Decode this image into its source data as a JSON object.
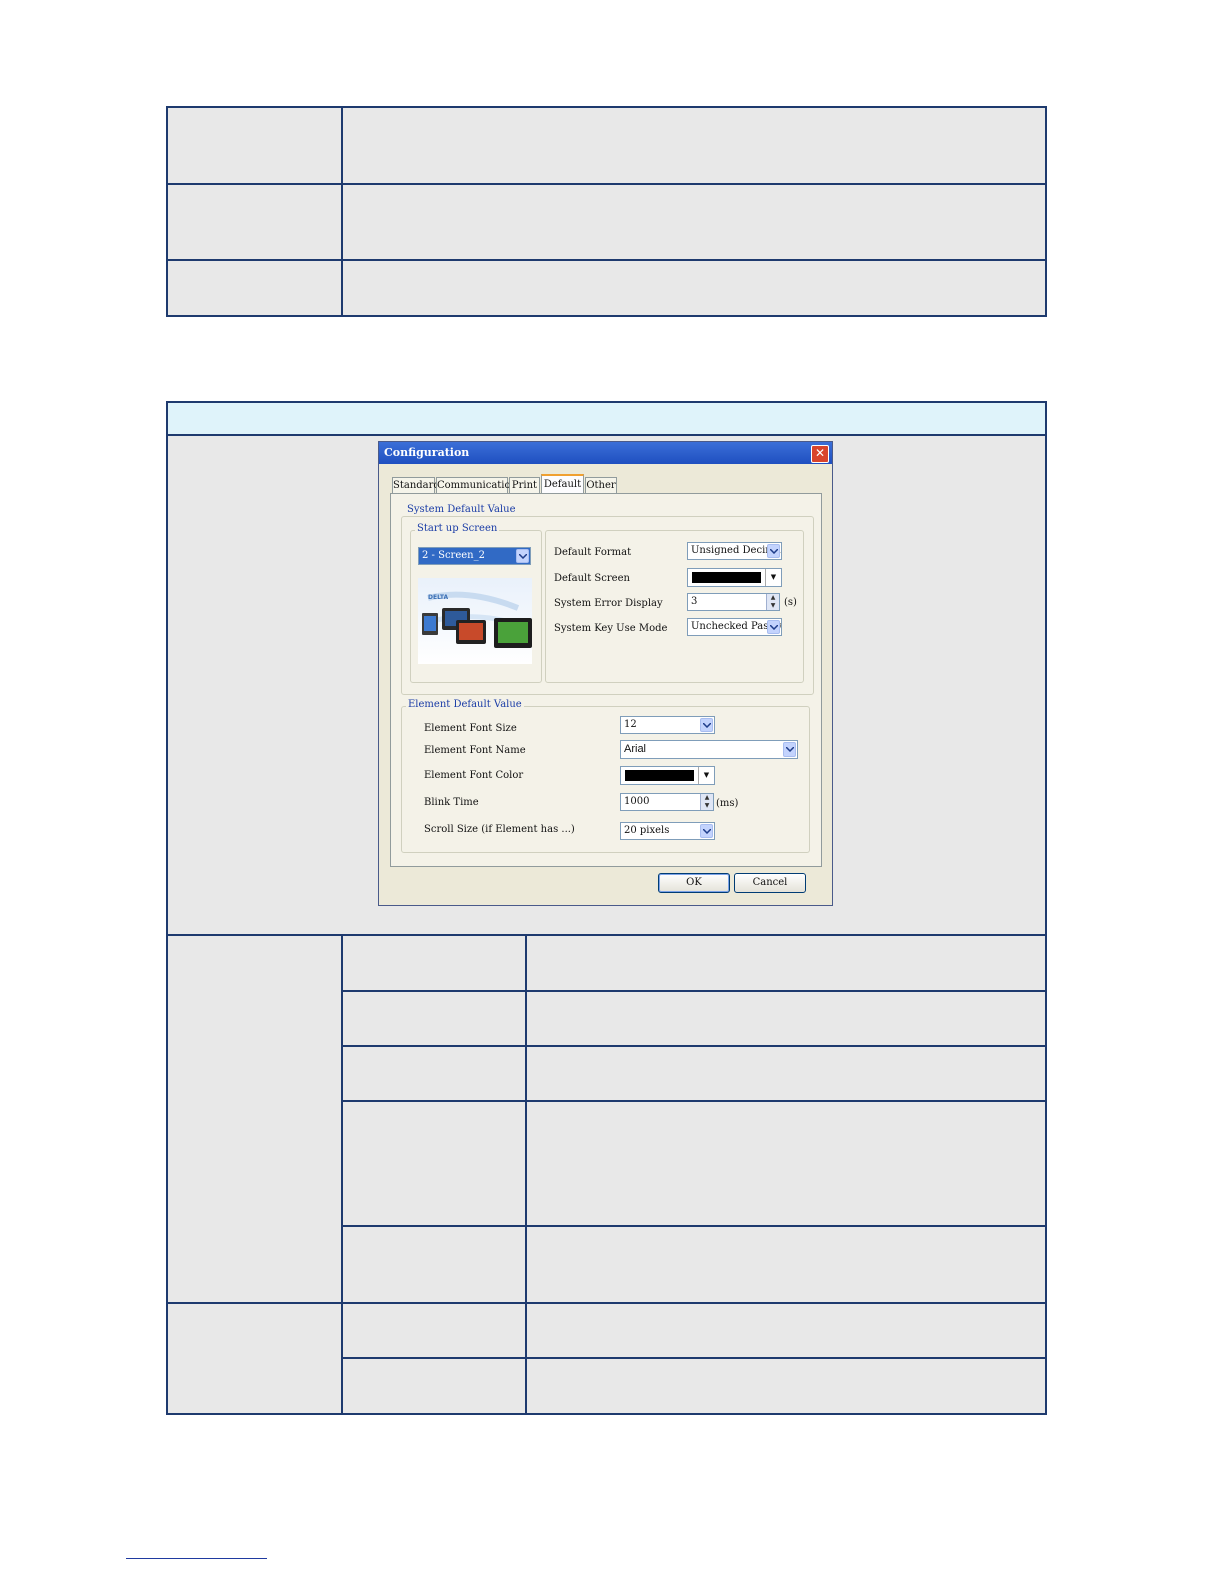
{
  "dialog": {
    "title": "Configuration",
    "close_glyph": "✕",
    "tabs": [
      {
        "label": "Standard"
      },
      {
        "label": "Communication"
      },
      {
        "label": "Print"
      },
      {
        "label": "Default",
        "active": true
      },
      {
        "label": "Other"
      }
    ],
    "system_default": {
      "group_label": "System Default Value",
      "startup": {
        "group_label": "Start up Screen",
        "selected": "2 - Screen_2",
        "thumbnail_logo": "DELTA"
      },
      "default_format": {
        "label": "Default Format",
        "value": "Unsigned Decimal"
      },
      "default_screen": {
        "label": "Default Screen",
        "color": "#000000"
      },
      "system_error_display": {
        "label": "System Error Display",
        "value": "3",
        "unit": "(s)"
      },
      "system_key_use_mode": {
        "label": "System Key Use Mode",
        "value": "Unchecked Passwo"
      }
    },
    "element_default": {
      "group_label": "Element Default Value",
      "font_size": {
        "label": "Element Font Size",
        "value": "12"
      },
      "font_name": {
        "label": "Element Font Name",
        "value": "Arial"
      },
      "font_color": {
        "label": "Element Font Color",
        "color": "#000000"
      },
      "blink_time": {
        "label": "Blink Time",
        "value": "1000",
        "unit": "(ms)"
      },
      "scroll_size": {
        "label": "Scroll Size (if Element has ...)",
        "value": "20 pixels"
      }
    },
    "buttons": {
      "ok": "OK",
      "cancel": "Cancel"
    }
  },
  "colors": {
    "table_border": "#1e3a6e",
    "table_fill": "#e8e8e8",
    "header_band": "#dff3fa",
    "titlebar": "#2a5cd0",
    "dialog_bg": "#ece9d8"
  }
}
